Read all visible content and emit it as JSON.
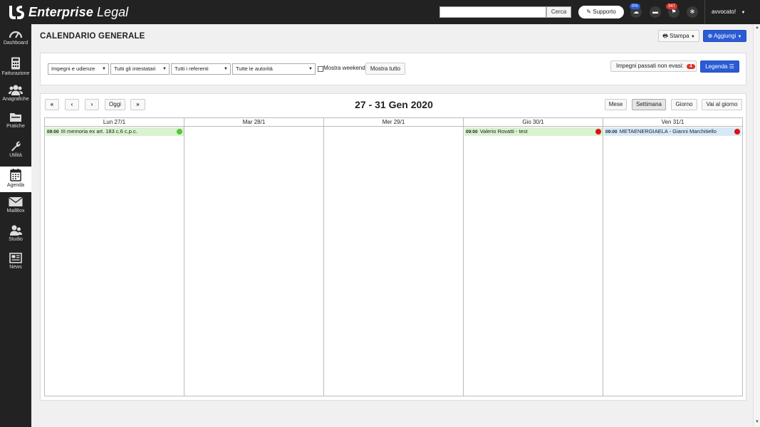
{
  "app": {
    "logo_bold": "Enterprise",
    "logo_light": "Legal"
  },
  "topbar": {
    "search_placeholder": "",
    "search_button": "Cerca",
    "support_label": "Supporto",
    "cloud_badge": "0%",
    "flag_badge": "347",
    "user_label": "avvocato!"
  },
  "sidebar": {
    "items": [
      {
        "label": "Dashboard",
        "icon": "gauge-icon"
      },
      {
        "label": "Fatturazione",
        "icon": "calculator-icon"
      },
      {
        "label": "Anagrafiche",
        "icon": "users-icon"
      },
      {
        "label": "Pratiche",
        "icon": "folder-icon"
      },
      {
        "label": "Utilità",
        "icon": "wrench-icon"
      },
      {
        "label": "Agenda",
        "icon": "calendar-icon"
      },
      {
        "label": "MailBox",
        "icon": "envelope-icon"
      },
      {
        "label": "Studio",
        "icon": "user-group-icon"
      },
      {
        "label": "News",
        "icon": "newspaper-icon"
      }
    ],
    "active": "Agenda"
  },
  "page": {
    "title": "CALENDARIO GENERALE",
    "print_button": "Stampa",
    "add_button": "Aggiungi"
  },
  "filters": {
    "type": "Impegni e udienze",
    "holders": "Tutti gli intestatari",
    "referents": "Tutti i referenti",
    "authorities": "Tutte le autorità",
    "weekend_label": "Mostra weekend",
    "weekend_checked": false,
    "show_all": "Mostra tutto",
    "overdue_label": "Impegni passati non evasi:",
    "overdue_count": "4",
    "legend_button": "Legenda"
  },
  "calendar": {
    "range_title": "27 - 31 Gen 2020",
    "today_button": "Oggi",
    "views": [
      "Mese",
      "Settimana",
      "Giorno",
      "Vai al giorno"
    ],
    "active_view": "Settimana",
    "days": [
      {
        "label": "Lun 27/1",
        "events": [
          {
            "time": "09:00",
            "text": "III memoria ex art. 183 c.6 c.p.c.",
            "bg": "#d9f2d0",
            "dot": "#5cc33c"
          }
        ]
      },
      {
        "label": "Mar 28/1",
        "events": []
      },
      {
        "label": "Mer 29/1",
        "events": []
      },
      {
        "label": "Gio 30/1",
        "events": [
          {
            "time": "09:00",
            "text": "Valerio Rovatti - test",
            "bg": "#d9f2d0",
            "dot": "#dd1111"
          }
        ]
      },
      {
        "label": "Ven 31/1",
        "events": [
          {
            "time": "09:00",
            "text": "METAENERGIAELA - Gianni Marchitiello",
            "bg": "#d6e9f8",
            "dot": "#dd1111"
          }
        ]
      }
    ]
  },
  "colors": {
    "topbar": "#222222",
    "primary": "#2b5bd4",
    "badge_red": "#d9342b",
    "badge_blue": "#2b5bd4"
  }
}
